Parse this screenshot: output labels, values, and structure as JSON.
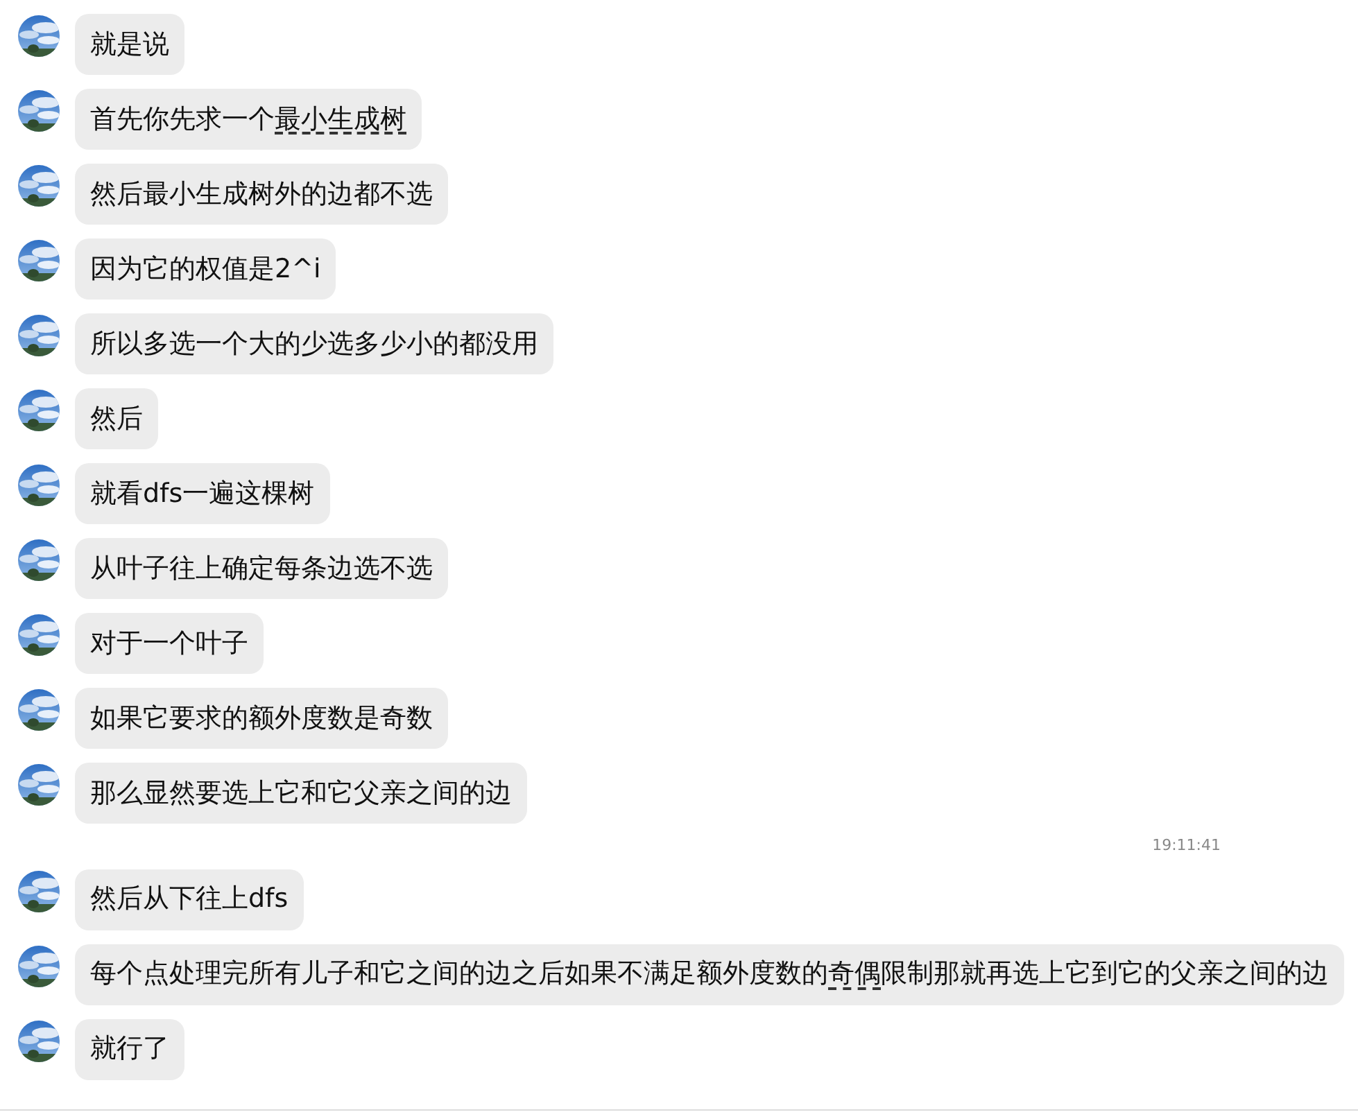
{
  "messages": [
    {
      "kind": "message",
      "parts": [
        {
          "text": "就是说",
          "underlined": false
        }
      ]
    },
    {
      "kind": "message",
      "parts": [
        {
          "text": "首先你先求一个",
          "underlined": false
        },
        {
          "text": "最小生成树",
          "underlined": true
        }
      ]
    },
    {
      "kind": "message",
      "parts": [
        {
          "text": "然后最小生成树外的边都不选",
          "underlined": false
        }
      ]
    },
    {
      "kind": "message",
      "parts": [
        {
          "text": "因为它的权值是2^i",
          "underlined": false
        }
      ]
    },
    {
      "kind": "message",
      "parts": [
        {
          "text": "所以多选一个大的少选多少小的都没用",
          "underlined": false
        }
      ]
    },
    {
      "kind": "message",
      "parts": [
        {
          "text": "然后",
          "underlined": false
        }
      ]
    },
    {
      "kind": "message",
      "parts": [
        {
          "text": "就看dfs一遍这棵树",
          "underlined": false
        }
      ]
    },
    {
      "kind": "message",
      "parts": [
        {
          "text": "从叶子往上确定每条边选不选",
          "underlined": false
        }
      ]
    },
    {
      "kind": "message",
      "parts": [
        {
          "text": "对于一个叶子",
          "underlined": false
        }
      ]
    },
    {
      "kind": "message",
      "parts": [
        {
          "text": "如果它要求的额外度数是奇数",
          "underlined": false
        }
      ]
    },
    {
      "kind": "message",
      "parts": [
        {
          "text": "那么显然要选上它和它父亲之间的边",
          "underlined": false
        }
      ]
    },
    {
      "kind": "time",
      "text": "19:11:41"
    },
    {
      "kind": "message",
      "parts": [
        {
          "text": "然后从下往上dfs",
          "underlined": false
        }
      ]
    },
    {
      "kind": "message",
      "parts": [
        {
          "text": "每个点处理完所有儿子和它之间的边之后如果不满足额外度数的",
          "underlined": false
        },
        {
          "text": "奇偶",
          "underlined": true
        },
        {
          "text": "限制那就再选上它到它的父亲之间的边",
          "underlined": false
        }
      ]
    },
    {
      "kind": "message",
      "parts": [
        {
          "text": "就行了",
          "underlined": false
        }
      ]
    }
  ]
}
